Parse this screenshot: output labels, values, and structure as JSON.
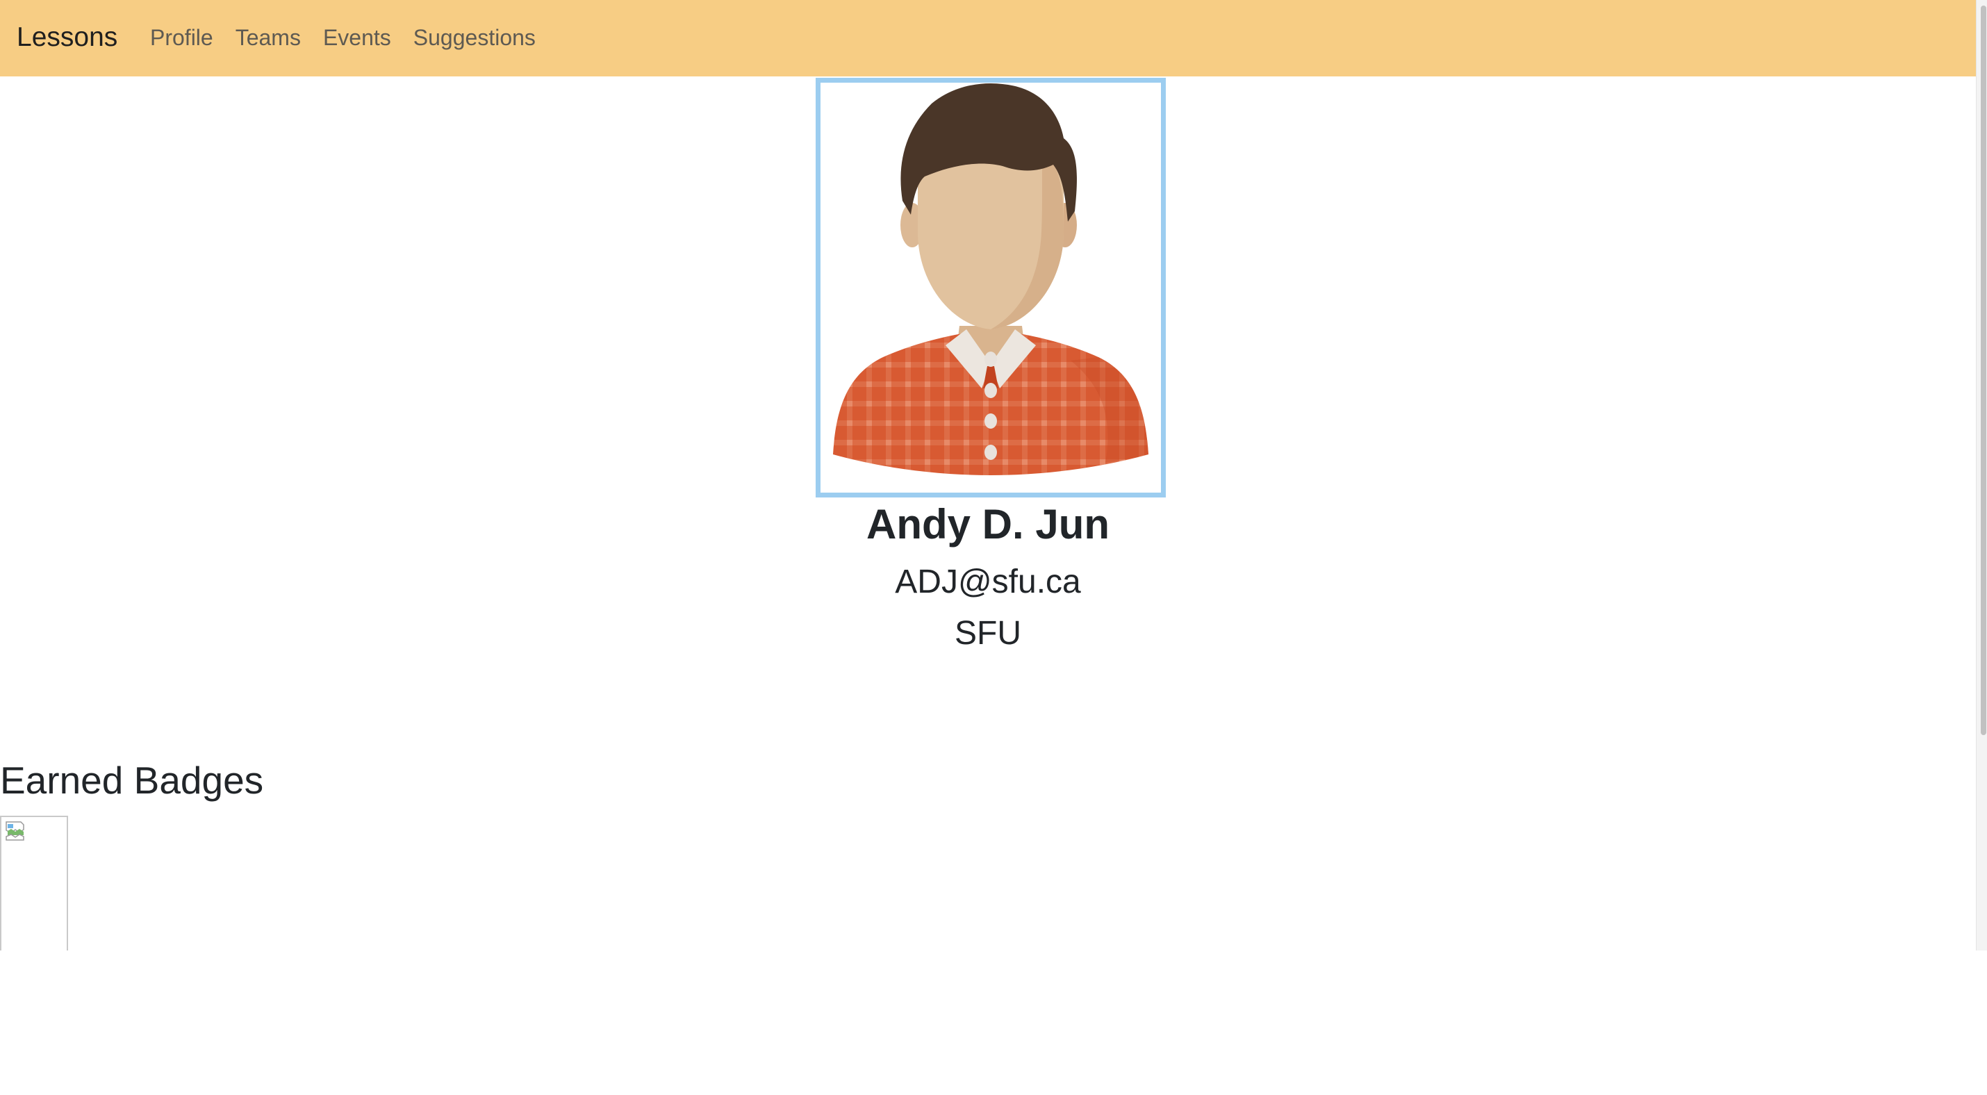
{
  "navbar": {
    "brand": "Lessons",
    "links": [
      "Profile",
      "Teams",
      "Events",
      "Suggestions"
    ],
    "background_color": "#f7cd84"
  },
  "profile": {
    "avatar_icon": "avatar-illustration",
    "avatar_border_color": "#9ccdf0",
    "name": "Andy D. Jun",
    "email": "ADJ@sfu.ca",
    "organization": "SFU"
  },
  "badges": {
    "title": "Earned Badges",
    "items": [
      {
        "icon": "broken-image-icon"
      }
    ]
  }
}
